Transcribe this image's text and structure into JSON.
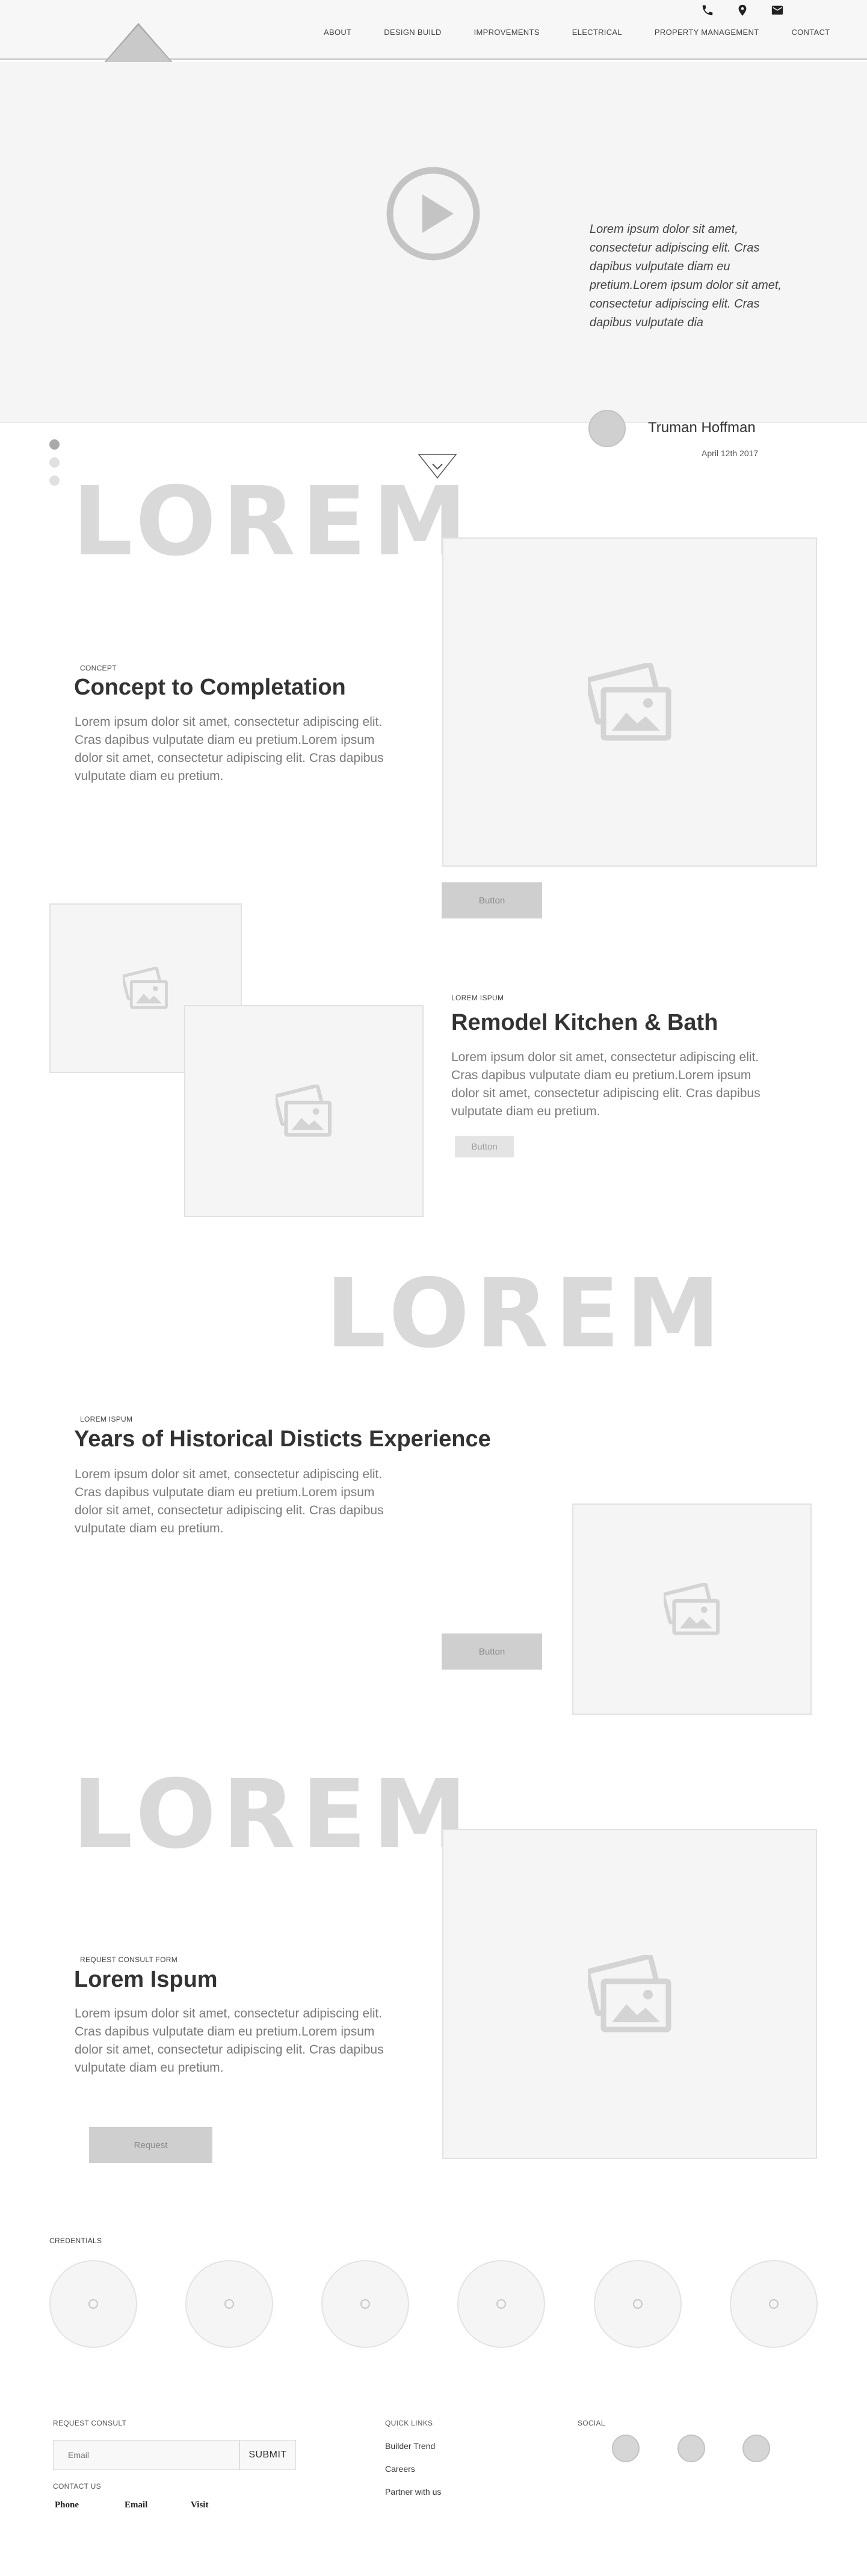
{
  "nav": {
    "items": [
      "ABOUT",
      "DESIGN BUILD",
      "IMPROVEMENTS",
      "ELECTRICAL",
      "PROPERTY MANAGEMENT",
      "CONTACT"
    ]
  },
  "icons": [
    "phone-icon",
    "location-pin-icon",
    "mail-icon",
    "play-icon",
    "chevron-down-icon",
    "image-icon"
  ],
  "hero": {
    "quote": "Lorem ipsum dolor sit amet, consectetur adipiscing elit. Cras dapibus vulputate diam eu pretium.Lorem ipsum dolor sit amet, consectetur adipiscing elit. Cras dapibus vulputate dia",
    "author": "Truman Hoffman",
    "date": "April 12th 2017"
  },
  "sections": {
    "concept": {
      "big_text": "LOREM",
      "eyebrow": "CONCEPT",
      "heading": "Concept to Completation",
      "body": "Lorem ipsum dolor sit amet, consectetur adipiscing elit. Cras dapibus vulputate diam eu pretium.Lorem ipsum dolor sit amet, consectetur adipiscing elit. Cras dapibus vulputate diam eu pretium.",
      "button": "Button"
    },
    "kitchen": {
      "eyebrow": "LOREM ISPUM",
      "heading": "Remodel Kitchen & Bath",
      "body": "Lorem ipsum dolor sit amet, consectetur adipiscing elit. Cras dapibus vulputate diam eu pretium.Lorem ipsum dolor sit amet, consectetur adipiscing elit. Cras dapibus vulputate diam eu pretium.",
      "button": "Button"
    },
    "historical": {
      "big_text": "LOREM",
      "eyebrow": "LOREM ISPUM",
      "heading": "Years of Historical Disticts Experience",
      "body": "Lorem ipsum dolor sit amet, consectetur adipiscing elit. Cras dapibus vulputate diam eu pretium.Lorem ipsum dolor sit amet, consectetur adipiscing elit. Cras dapibus vulputate diam eu pretium.",
      "button": "Button"
    },
    "consult": {
      "big_text": "LOREM",
      "eyebrow": "REQUEST CONSULT FORM",
      "heading": "Lorem Ispum",
      "body": "Lorem ipsum dolor sit amet, consectetur adipiscing elit. Cras dapibus vulputate diam eu pretium.Lorem ipsum dolor sit amet, consectetur adipiscing elit. Cras dapibus vulputate diam eu pretium.",
      "button": "Request"
    }
  },
  "credentials": {
    "label": "CREDENTIALS"
  },
  "footer": {
    "request_label": "REQUEST CONSULT",
    "email_placeholder": "Email",
    "submit": "SUBMIT",
    "contact_label": "CONTACT US",
    "contact_items": [
      "Phone",
      "Email",
      "Visit"
    ],
    "quick_links_label": "QUICK LINKS",
    "quick_links": [
      "Builder Trend",
      "Careers",
      "Partner with us"
    ],
    "social_label": "SOCIAL"
  }
}
